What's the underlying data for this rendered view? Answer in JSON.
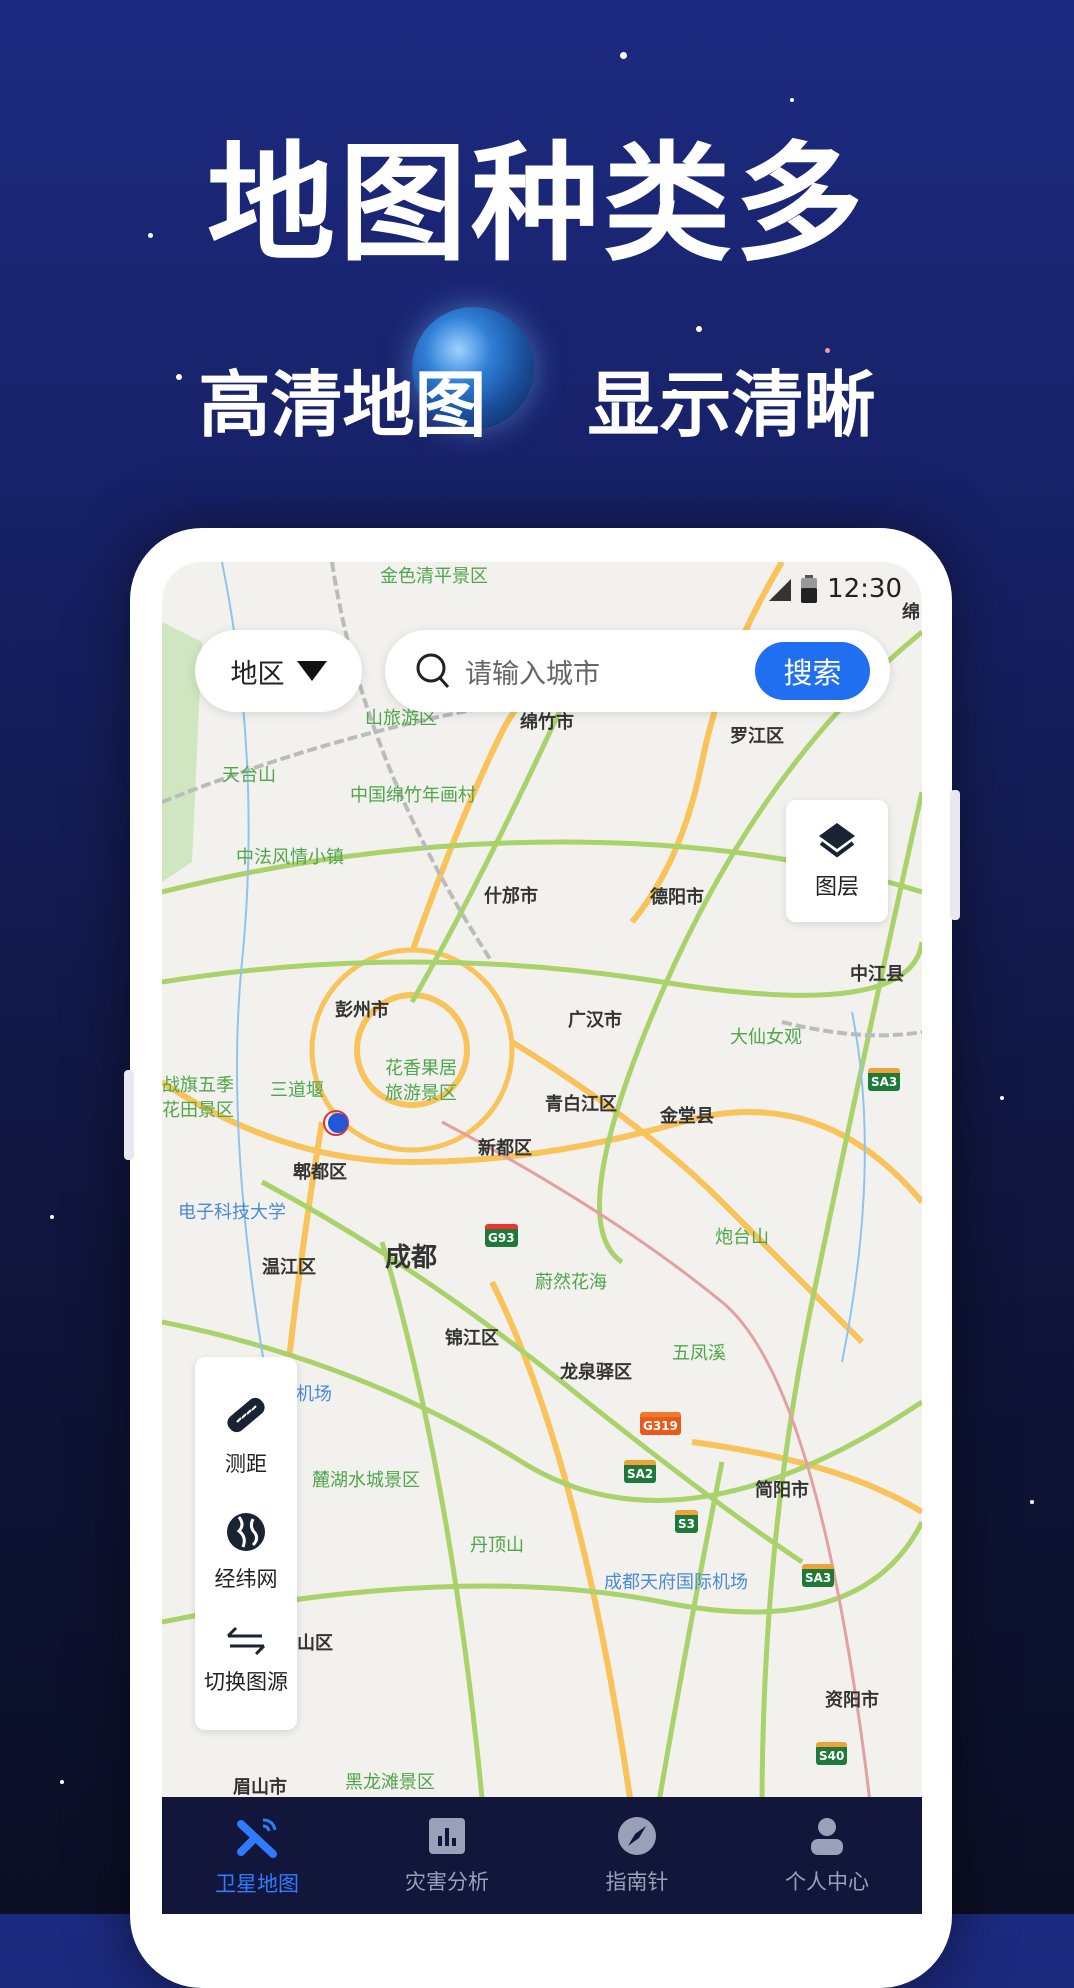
{
  "hero": {
    "title": "地图种类多",
    "subtitle_left": "高清地图",
    "subtitle_right": "显示清晰"
  },
  "status_bar": {
    "time": "12:30"
  },
  "top_bar": {
    "region_label": "地区",
    "search_placeholder": "请输入城市",
    "search_button": "搜索"
  },
  "layer_button": {
    "label": "图层",
    "icon": "layers-icon"
  },
  "tools": [
    {
      "label": "测距",
      "icon": "ruler-icon"
    },
    {
      "label": "经纬网",
      "icon": "globe-icon"
    },
    {
      "label": "切换图源",
      "icon": "swap-icon"
    }
  ],
  "bottom_nav": [
    {
      "label": "卫星地图",
      "icon": "satellite-icon",
      "active": true
    },
    {
      "label": "灾害分析",
      "icon": "bar-chart-icon"
    },
    {
      "label": "指南针",
      "icon": "compass-icon"
    },
    {
      "label": "个人中心",
      "icon": "user-icon"
    }
  ],
  "map": {
    "labels": [
      "金色清平景区",
      "山旅游区",
      "绵竹市",
      "罗江区",
      "天台山",
      "中国绵竹年画村",
      "中法风情小镇",
      "什邡市",
      "德阳市",
      "中江县",
      "彭州市",
      "广汉市",
      "大仙女观",
      "战旗五季",
      "花田景区",
      "三道堰",
      "花香果居",
      "旅游景区",
      "青白江区",
      "金堂县",
      "新都区",
      "郫都区",
      "电子科技大学",
      "成都",
      "炮台山",
      "温江区",
      "蔚然花海",
      "锦江区",
      "五凤溪",
      "流国际机场",
      "龙泉驿区",
      "麓湖水城景区",
      "简阳市",
      "丹顶山",
      "成都天府国际机场",
      "山区",
      "资阳市",
      "眉山市",
      "黑龙滩景区",
      "绵"
    ],
    "shields": [
      "G93",
      "G319",
      "SA2",
      "S3",
      "SA3",
      "SA3",
      "S40"
    ]
  },
  "colors": {
    "accent": "#1f6ff0",
    "nav_bg": "#11163a",
    "nav_active": "#2f7bff"
  }
}
